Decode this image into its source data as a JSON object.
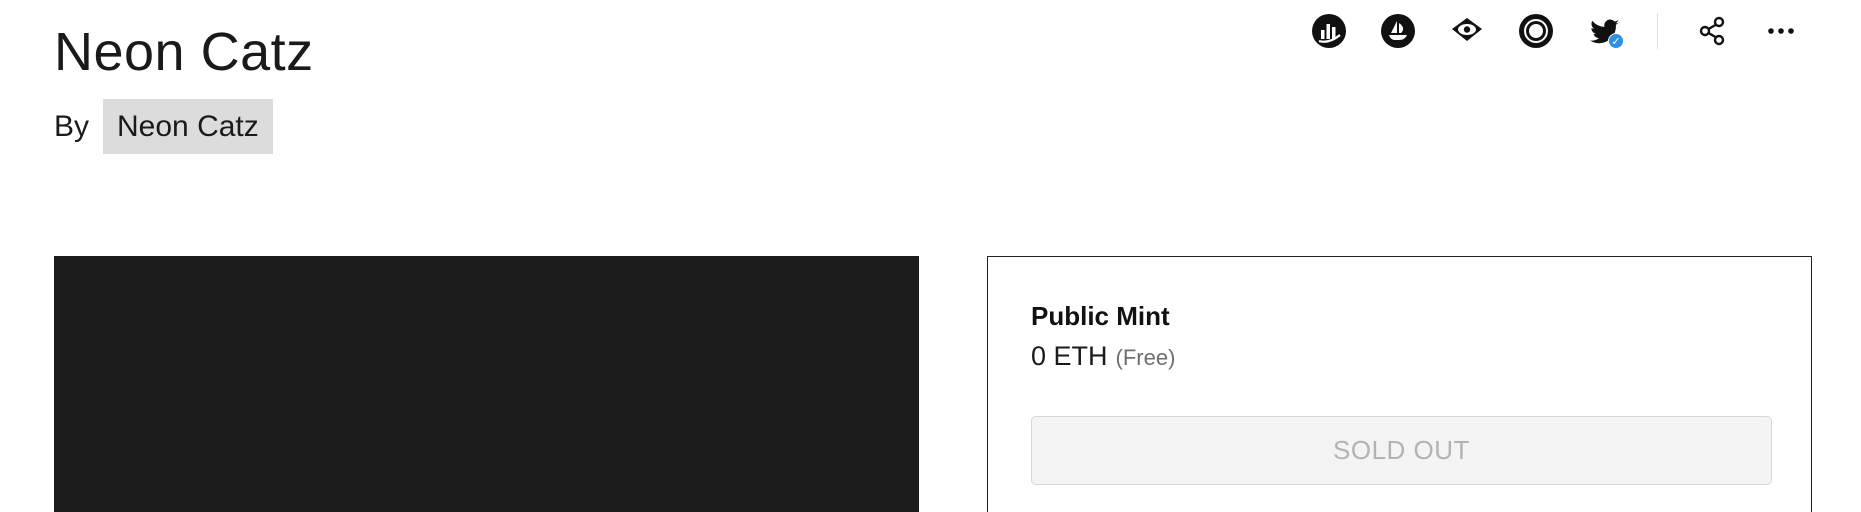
{
  "collection": {
    "title": "Neon Catz",
    "by_label": "By",
    "creator": "Neon Catz"
  },
  "header_icons": [
    {
      "name": "chart-bars-icon",
      "label": "analytics"
    },
    {
      "name": "opensea-icon",
      "label": "OpenSea"
    },
    {
      "name": "eye-icon",
      "label": "watch"
    },
    {
      "name": "rings-icon",
      "label": "looksrare"
    },
    {
      "name": "twitter-verified-icon",
      "label": "Twitter"
    },
    {
      "name": "share-icon",
      "label": "share"
    },
    {
      "name": "more-icon",
      "label": "more"
    }
  ],
  "mint": {
    "title": "Public Mint",
    "price": "0 ETH",
    "price_note": "(Free)",
    "button_label": "SOLD OUT"
  },
  "colors": {
    "media_background": "#1c1c1c",
    "creator_chip": "#dcdcdc",
    "verified_badge": "#2f8fe0",
    "button_disabled_text": "#b3b3b3"
  }
}
